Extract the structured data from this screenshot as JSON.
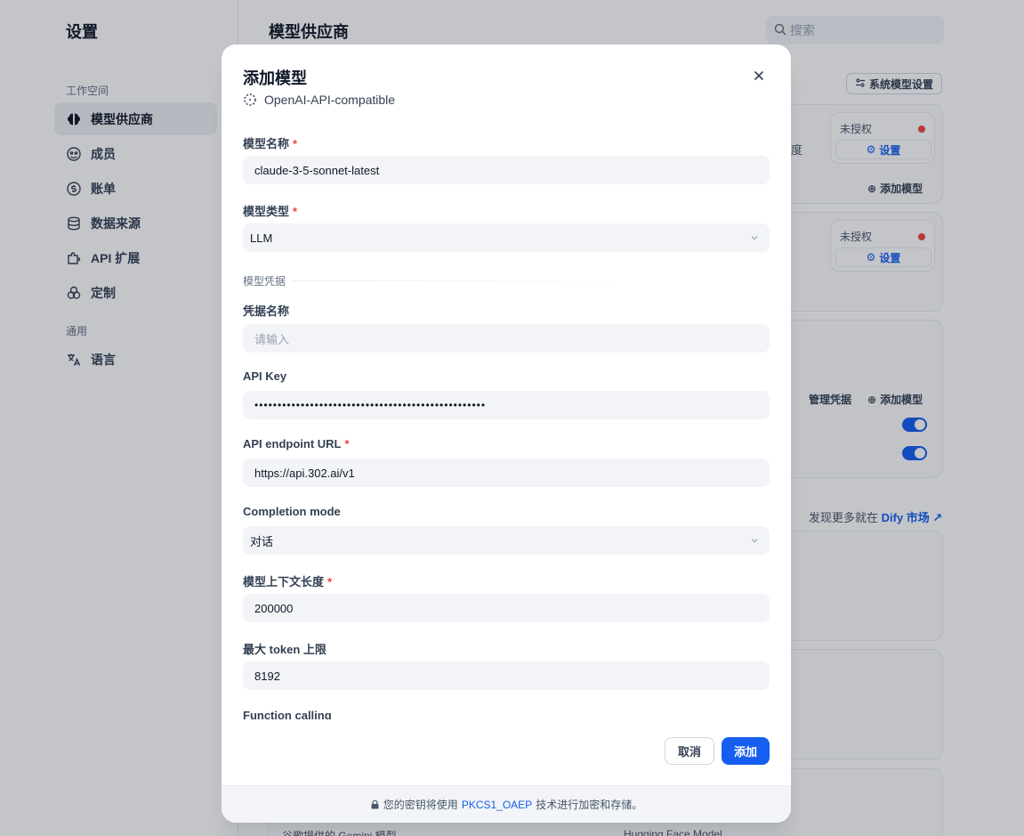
{
  "sidebar": {
    "title": "设置",
    "group_workspace": "工作空间",
    "group_general": "通用",
    "items": [
      {
        "label": "模型供应商",
        "icon": "brain-icon",
        "active": true
      },
      {
        "label": "成员",
        "icon": "members-icon"
      },
      {
        "label": "账单",
        "icon": "billing-icon"
      },
      {
        "label": "数据来源",
        "icon": "database-icon"
      },
      {
        "label": "API 扩展",
        "icon": "puzzle-icon"
      },
      {
        "label": "定制",
        "icon": "customize-icon"
      },
      {
        "label": "语言",
        "icon": "translate-icon"
      }
    ]
  },
  "main": {
    "title": "模型供应商",
    "search_placeholder": "搜索",
    "system_model_settings": "系统模型设置",
    "unauthorized": "未授权",
    "setup": "设置",
    "add_model": "添加模型",
    "manage_credentials": "管理凭据",
    "discover_prefix": "发现更多就在",
    "discover_link": "Dify 市场",
    "partial_1": "度",
    "partial_2": "谷歌提供的 Gemini 模型",
    "partial_3": "Hugging Face Model"
  },
  "modal": {
    "title": "添加模型",
    "provider": "OpenAI-API-compatible",
    "fields": {
      "model_name": {
        "label": "模型名称",
        "value": "claude-3-5-sonnet-latest"
      },
      "model_type": {
        "label": "模型类型",
        "value": "LLM"
      },
      "credentials_section": "模型凭据",
      "credential_name": {
        "label": "凭据名称",
        "placeholder": "请输入"
      },
      "api_key": {
        "label": "API Key",
        "value": "••••••••••••••••••••••••••••••••••••••••••••••••••"
      },
      "endpoint": {
        "label": "API endpoint URL",
        "value": "https://api.302.ai/v1"
      },
      "completion_mode": {
        "label": "Completion mode",
        "value": "对话"
      },
      "context_length": {
        "label": "模型上下文长度",
        "value": "200000"
      },
      "max_tokens": {
        "label": "最大 token 上限",
        "value": "8192"
      },
      "function_calling": {
        "label": "Function calling"
      }
    },
    "required_mark": "*",
    "cancel": "取消",
    "add": "添加",
    "footer_prefix": "您的密钥将使用",
    "footer_link": "PKCS1_OAEP",
    "footer_suffix": "技术进行加密和存储。"
  },
  "colors": {
    "accent": "#155eef",
    "required": "#f04438",
    "input_bg": "#f2f4f7"
  }
}
